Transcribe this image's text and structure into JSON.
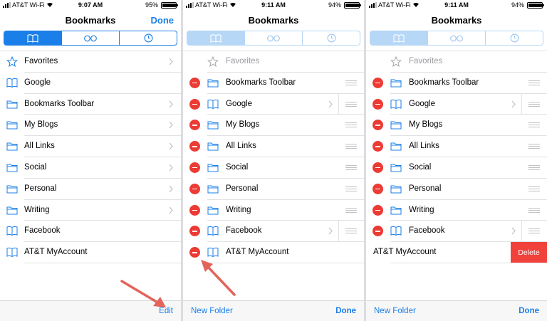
{
  "colors": {
    "accent": "#1a7fe8",
    "delete": "#ec3b34",
    "annotation_arrow": "#e2645a"
  },
  "panels": [
    {
      "status": {
        "carrier": "AT&T Wi-Fi",
        "time": "9:07 AM",
        "battery": "95%",
        "battery_level": 0.95
      },
      "nav": {
        "title": "Bookmarks",
        "done": "Done"
      },
      "segments": [
        "bookmarks-icon",
        "reading-list-icon",
        "history-icon"
      ],
      "rows": [
        {
          "label": "Favorites",
          "icon": "star-icon"
        },
        {
          "label": "Google",
          "icon": "book-icon"
        },
        {
          "label": "Bookmarks Toolbar",
          "icon": "folder-icon"
        },
        {
          "label": "My Blogs",
          "icon": "folder-icon"
        },
        {
          "label": "All Links",
          "icon": "folder-icon"
        },
        {
          "label": "Social",
          "icon": "folder-icon"
        },
        {
          "label": "Personal",
          "icon": "folder-icon"
        },
        {
          "label": "Writing",
          "icon": "folder-icon"
        },
        {
          "label": "Facebook",
          "icon": "book-icon"
        },
        {
          "label": "AT&T MyAccount",
          "icon": "book-icon"
        }
      ],
      "toolbar": {
        "right": "Edit"
      }
    },
    {
      "status": {
        "carrier": "AT&T Wi-Fi",
        "time": "9:11 AM",
        "battery": "94%",
        "battery_level": 0.94
      },
      "nav": {
        "title": "Bookmarks"
      },
      "rows": [
        {
          "label": "Favorites",
          "icon": "star-icon"
        },
        {
          "label": "Bookmarks Toolbar",
          "icon": "folder-icon"
        },
        {
          "label": "Google",
          "icon": "book-icon"
        },
        {
          "label": "My Blogs",
          "icon": "folder-icon"
        },
        {
          "label": "All Links",
          "icon": "folder-icon"
        },
        {
          "label": "Social",
          "icon": "folder-icon"
        },
        {
          "label": "Personal",
          "icon": "folder-icon"
        },
        {
          "label": "Writing",
          "icon": "folder-icon"
        },
        {
          "label": "Facebook",
          "icon": "book-icon"
        },
        {
          "label": "AT&T MyAccount",
          "icon": "book-icon"
        }
      ],
      "toolbar": {
        "left": "New Folder",
        "right": "Done"
      }
    },
    {
      "status": {
        "carrier": "AT&T Wi-Fi",
        "time": "9:11 AM",
        "battery": "94%",
        "battery_level": 0.94
      },
      "nav": {
        "title": "Bookmarks"
      },
      "rows": [
        {
          "label": "Favorites",
          "icon": "star-icon"
        },
        {
          "label": "Bookmarks Toolbar",
          "icon": "folder-icon"
        },
        {
          "label": "Google",
          "icon": "book-icon"
        },
        {
          "label": "My Blogs",
          "icon": "folder-icon"
        },
        {
          "label": "All Links",
          "icon": "folder-icon"
        },
        {
          "label": "Social",
          "icon": "folder-icon"
        },
        {
          "label": "Personal",
          "icon": "folder-icon"
        },
        {
          "label": "Writing",
          "icon": "folder-icon"
        },
        {
          "label": "Facebook",
          "icon": "book-icon"
        },
        {
          "label": "AT&T MyAccount"
        }
      ],
      "delete_label": "Delete",
      "toolbar": {
        "left": "New Folder",
        "right": "Done"
      }
    }
  ]
}
